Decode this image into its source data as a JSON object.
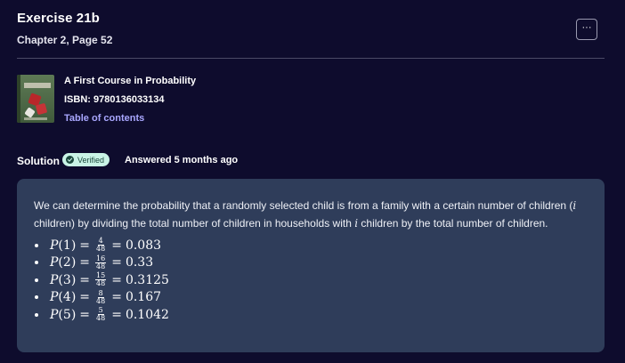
{
  "header": {
    "title": "Exercise 21b",
    "subtitle": "Chapter 2, Page 52",
    "more_label": "···"
  },
  "book": {
    "title": "A First Course in Probability",
    "isbn": "ISBN: 9780136033134",
    "toc_label": "Table of contents"
  },
  "solution": {
    "label": "Solution",
    "badge": "Verified",
    "answered": "Answered 5 months ago",
    "text_part1": "We can determine the probability that a randomly selected child is from a family with a certain number of children (",
    "var_i": "i",
    "text_part2": " children) by dividing the total number of children in households with ",
    "text_part3": " children by the total number of children.",
    "items": [
      {
        "lhs_fn": "P",
        "arg": "1",
        "num": "4",
        "den": "48",
        "result": "0.083"
      },
      {
        "lhs_fn": "P",
        "arg": "2",
        "num": "16",
        "den": "48",
        "result": "0.33"
      },
      {
        "lhs_fn": "P",
        "arg": "3",
        "num": "15",
        "den": "48",
        "result": "0.3125"
      },
      {
        "lhs_fn": "P",
        "arg": "4",
        "num": "8",
        "den": "48",
        "result": "0.167"
      },
      {
        "lhs_fn": "P",
        "arg": "5",
        "num": "5",
        "den": "48",
        "result": "0.1042"
      }
    ]
  },
  "colors": {
    "background": "#0e0c2d",
    "card": "#2f3d5a",
    "link": "#a9a7ff",
    "badge_bg": "#c9f4e6",
    "badge_fg": "#1c4a3e"
  },
  "icons": {
    "more": "more-options-icon",
    "verified": "check-circle-icon",
    "cover": "book-cover-image"
  }
}
